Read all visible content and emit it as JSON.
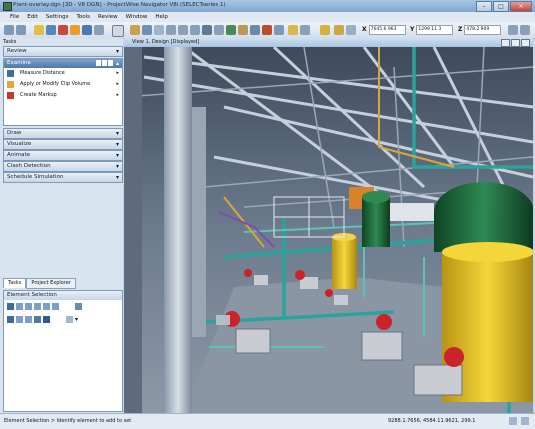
{
  "window": {
    "title": "Plant-overlay.dgn [3D - V8 DGN] - ProjectWise Navigator V8i (SELECTseries 1)"
  },
  "menu": [
    "File",
    "Edit",
    "Settings",
    "Tools",
    "Review",
    "Window",
    "Help"
  ],
  "coordinates": {
    "x_label": "X",
    "x_value": "7645.6 963",
    "y_label": "Y",
    "y_value": "1299 11 3",
    "z_label": "Z",
    "z_value": "478.2 909"
  },
  "left_panel": {
    "review_label": "Review",
    "examine": {
      "label": "Examine",
      "items": [
        "Measure Distance",
        "Apply or Modify Clip Volume",
        "Create Markup"
      ]
    },
    "collapsed_sections": [
      "Draw",
      "Visualize",
      "Animate",
      "Clash Detection",
      "Schedule Simulation"
    ],
    "tasks_label": "Tasks",
    "tabs": [
      "Tasks",
      "Project Explorer"
    ],
    "element_selection_label": "Element Selection"
  },
  "view": {
    "title": "View 1, Design [Displayed]"
  },
  "status": {
    "message": "Element Selection > Identify element to add to set",
    "coords": "9288.1.7656, 4584.11.9621, 299.1"
  },
  "colors": {
    "title_bar": "#7fa6cf",
    "panel_header": "#4f79a8",
    "structure_steel": "#b8c4d2",
    "pipe_teal": "#2aa39a",
    "tank_yellow": "#e9c21a",
    "pump_red": "#c8242a",
    "tank_green": "#1f6a3c"
  }
}
